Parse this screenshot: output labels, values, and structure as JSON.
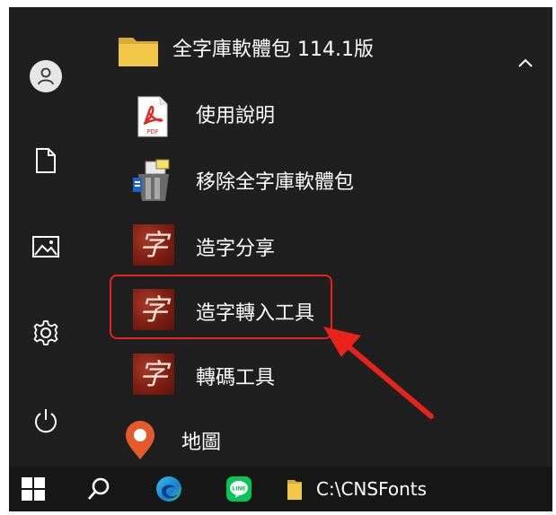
{
  "start_menu": {
    "folder": {
      "label": "全字庫軟體包 114.1版",
      "icon": "folder-icon",
      "expanded": true,
      "collapse_icon": "chevron-up-icon"
    },
    "items": [
      {
        "label": "使用說明",
        "icon": "pdf-icon"
      },
      {
        "label": "移除全字庫軟體包",
        "icon": "uninstall-icon"
      },
      {
        "label": "造字分享",
        "icon": "zi-glyph-icon"
      },
      {
        "label": "造字轉入工具",
        "icon": "zi-glyph-icon",
        "highlighted": true
      },
      {
        "label": "轉碼工具",
        "icon": "zi-glyph-icon"
      },
      {
        "label": "地圖",
        "icon": "map-pin-icon"
      }
    ],
    "pdf_badge": "PDF",
    "app_glyph": "字"
  },
  "rail": {
    "items": [
      "user-avatar-icon",
      "document-icon",
      "pictures-icon",
      "settings-gear-icon",
      "power-icon"
    ]
  },
  "taskbar": {
    "items": [
      "windows-start-icon",
      "search-icon",
      "edge-browser-icon",
      "line-app-icon",
      "folder-icon"
    ],
    "line_badge": "LINE",
    "explorer_label": "C:\\CNSFonts"
  },
  "colors": {
    "highlight": "#e8231c",
    "menu_background": "#1f1f1f",
    "folder": "#f2c84b",
    "glyph_tile": "#7e1f14"
  }
}
